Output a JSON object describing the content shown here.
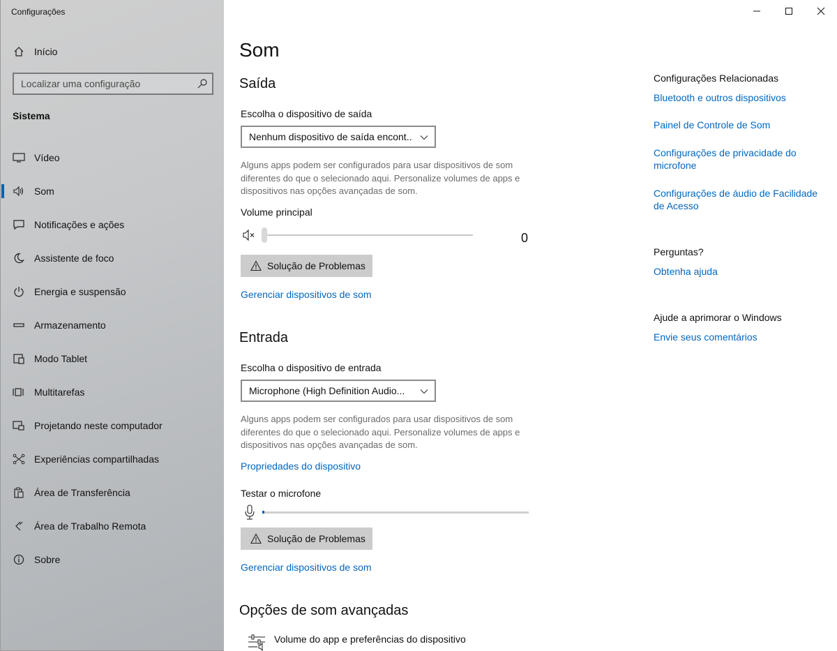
{
  "app": {
    "title": "Configurações"
  },
  "sidebar": {
    "home_label": "Início",
    "search_placeholder": "Localizar uma configuração",
    "section": "Sistema",
    "items": [
      {
        "label": "Vídeo",
        "icon": "monitor-icon"
      },
      {
        "label": "Som",
        "icon": "speaker-icon",
        "active": true
      },
      {
        "label": "Notificações e ações",
        "icon": "notification-icon"
      },
      {
        "label": "Assistente de foco",
        "icon": "moon-icon"
      },
      {
        "label": "Energia e suspensão",
        "icon": "power-icon"
      },
      {
        "label": "Armazenamento",
        "icon": "storage-icon"
      },
      {
        "label": "Modo Tablet",
        "icon": "tablet-icon"
      },
      {
        "label": "Multitarefas",
        "icon": "multitask-icon"
      },
      {
        "label": "Projetando neste computador",
        "icon": "project-icon"
      },
      {
        "label": "Experiências compartilhadas",
        "icon": "shared-icon"
      },
      {
        "label": "Área de Transferência",
        "icon": "clipboard-icon"
      },
      {
        "label": "Área de Trabalho Remota",
        "icon": "remote-icon"
      },
      {
        "label": "Sobre",
        "icon": "info-icon"
      }
    ]
  },
  "main": {
    "title": "Som",
    "output": {
      "heading": "Saída",
      "device_label": "Escolha o dispositivo de saída",
      "device_value": "Nenhum dispositivo de saída encont...",
      "description": "Alguns apps podem ser configurados para usar dispositivos de som diferentes do que o selecionado aqui. Personalize volumes de apps e dispositivos nas opções avançadas de som.",
      "volume_label": "Volume principal",
      "volume_value": "0",
      "troubleshoot": "Solução de Problemas",
      "manage_link": "Gerenciar dispositivos de som"
    },
    "input": {
      "heading": "Entrada",
      "device_label": "Escolha o dispositivo de entrada",
      "device_value": "Microphone (High Definition Audio...",
      "description": "Alguns apps podem ser configurados para usar dispositivos de som diferentes do que o selecionado aqui. Personalize volumes de apps e dispositivos nas opções avançadas de som.",
      "properties_link": "Propriedades do dispositivo",
      "test_label": "Testar o microfone",
      "troubleshoot": "Solução de Problemas",
      "manage_link": "Gerenciar dispositivos de som"
    },
    "advanced": {
      "heading": "Opções de som avançadas",
      "app_volume_label": "Volume do app e preferências do dispositivo"
    }
  },
  "related": {
    "heading": "Configurações Relacionadas",
    "links": [
      "Bluetooth e outros dispositivos",
      "Painel de Controle de Som",
      "Configurações de privacidade do microfone",
      "Configurações de áudio de Facilidade de Acesso"
    ],
    "questions_heading": "Perguntas?",
    "help_link": "Obtenha ajuda",
    "improve_heading": "Ajude a aprimorar o Windows",
    "feedback_link": "Envie seus comentários"
  },
  "colors": {
    "accent": "#0063b1",
    "link": "#0067c0"
  }
}
